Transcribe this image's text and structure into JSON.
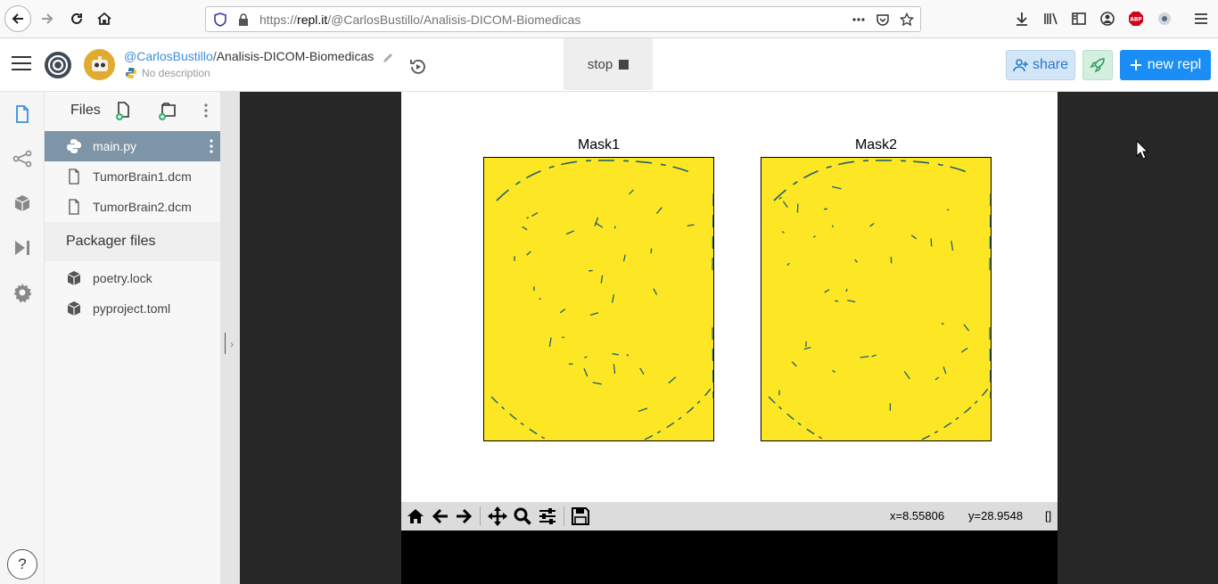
{
  "browser": {
    "url_scheme_prefix": "https://",
    "url_host": "repl.it",
    "url_path": "/@CarlosBustillo/Analisis-DICOM-Biomedicas"
  },
  "repl": {
    "owner": "@CarlosBustillo",
    "separator": "/",
    "name": "Analisis-DICOM-Biomedicas",
    "description": "No description",
    "stop_label": "stop",
    "share_label": "share",
    "new_repl_label": "new repl"
  },
  "files": {
    "title": "Files",
    "items": [
      {
        "name": "main.py",
        "icon": "python-icon",
        "active": true
      },
      {
        "name": "TumorBrain1.dcm",
        "icon": "file-icon",
        "active": false
      },
      {
        "name": "TumorBrain2.dcm",
        "icon": "file-icon",
        "active": false
      }
    ],
    "packager_title": "Packager files",
    "packager_items": [
      {
        "name": "poetry.lock",
        "icon": "package-icon"
      },
      {
        "name": "pyproject.toml",
        "icon": "package-icon"
      }
    ]
  },
  "plot": {
    "subplots": [
      {
        "title": "Mask1"
      },
      {
        "title": "Mask2"
      }
    ],
    "mask_color": "#fde725",
    "edge_color": "#1f5f6f",
    "coord_x": "x=8.55806",
    "coord_y": "y=28.9548",
    "coord_extra": "[]"
  },
  "help_label": "?",
  "colors": {
    "accent": "#1b8ef5",
    "active_file": "#7d95a6",
    "share_bg": "#d2e6f8"
  }
}
